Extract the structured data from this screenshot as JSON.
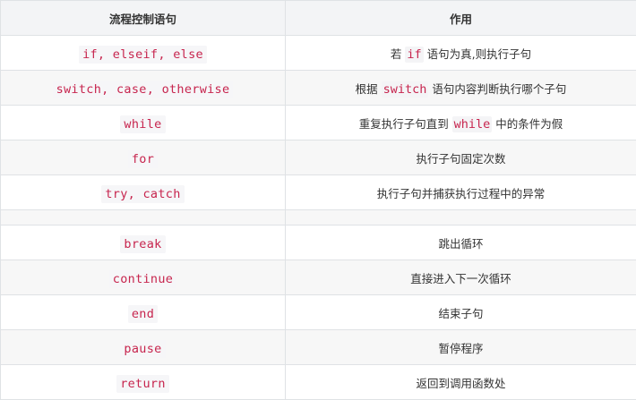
{
  "table": {
    "headers": [
      "流程控制语句",
      "作用"
    ],
    "rows": [
      {
        "statement": "if, elseif, else",
        "desc_before": "若 ",
        "desc_code": "if",
        "desc_after": " 语句为真,则执行子句"
      },
      {
        "statement": "switch, case, otherwise",
        "desc_before": "根据 ",
        "desc_code": "switch",
        "desc_after": " 语句内容判断执行哪个子句"
      },
      {
        "statement": "while",
        "desc_before": "重复执行子句直到 ",
        "desc_code": "while",
        "desc_after": " 中的条件为假"
      },
      {
        "statement": "for",
        "desc": "执行子句固定次数"
      },
      {
        "statement": "try, catch",
        "desc": "执行子句并捕获执行过程中的异常"
      },
      {
        "statement": "",
        "desc": ""
      },
      {
        "statement": "break",
        "desc": "跳出循环"
      },
      {
        "statement": "continue",
        "desc": "直接进入下一次循环"
      },
      {
        "statement": "end",
        "desc": "结束子句"
      },
      {
        "statement": "pause",
        "desc": "暂停程序"
      },
      {
        "statement": "return",
        "desc": "返回到调用函数处"
      }
    ]
  },
  "colors": {
    "header_bg": "#f3f4f6",
    "stripe_bg": "#f7f7f7",
    "border": "#dfe2e5",
    "code_text": "#c7254e",
    "code_bg": "#f6f6f8"
  }
}
